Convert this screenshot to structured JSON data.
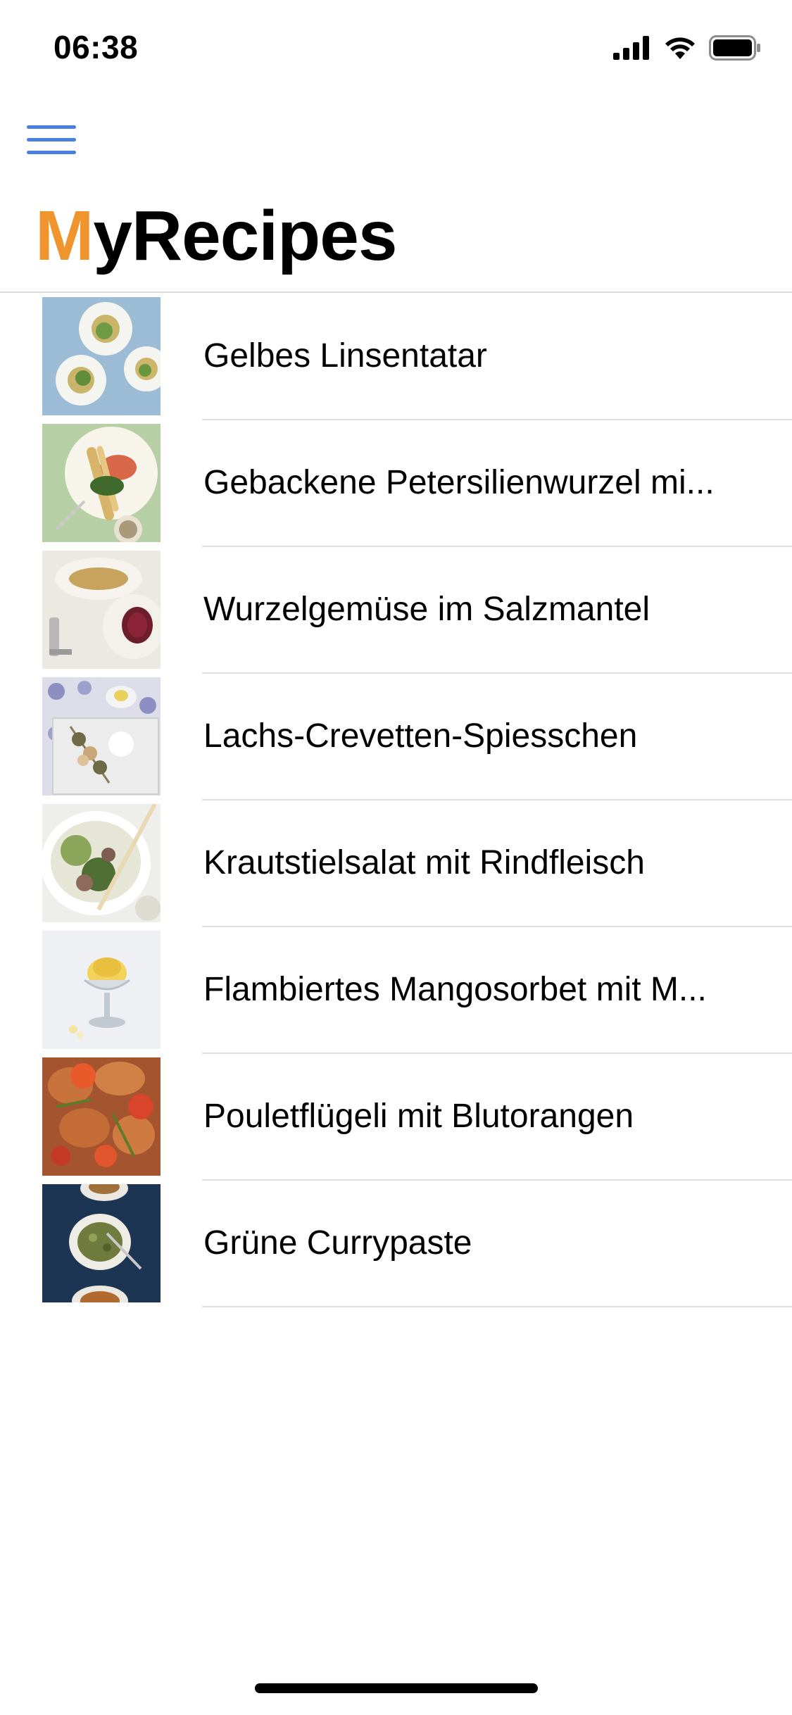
{
  "status_bar": {
    "time": "06:38"
  },
  "header": {
    "menu_icon": "hamburger-menu-icon",
    "title_accent": "M",
    "title_rest": "yRecipes",
    "accent_color": "#f0952e",
    "menu_color": "#4a7fe0"
  },
  "recipes": [
    {
      "title": "Gelbes Linsentatar"
    },
    {
      "title": "Gebackene Petersilienwurzel mi..."
    },
    {
      "title": "Wurzelgemüse im Salzmantel"
    },
    {
      "title": "Lachs-Crevetten-Spiesschen"
    },
    {
      "title": "Krautstielsalat mit Rindfleisch"
    },
    {
      "title": "Flambiertes Mangosorbet mit M..."
    },
    {
      "title": "Pouletflügeli mit Blutorangen"
    },
    {
      "title": "Grüne Currypaste"
    }
  ]
}
